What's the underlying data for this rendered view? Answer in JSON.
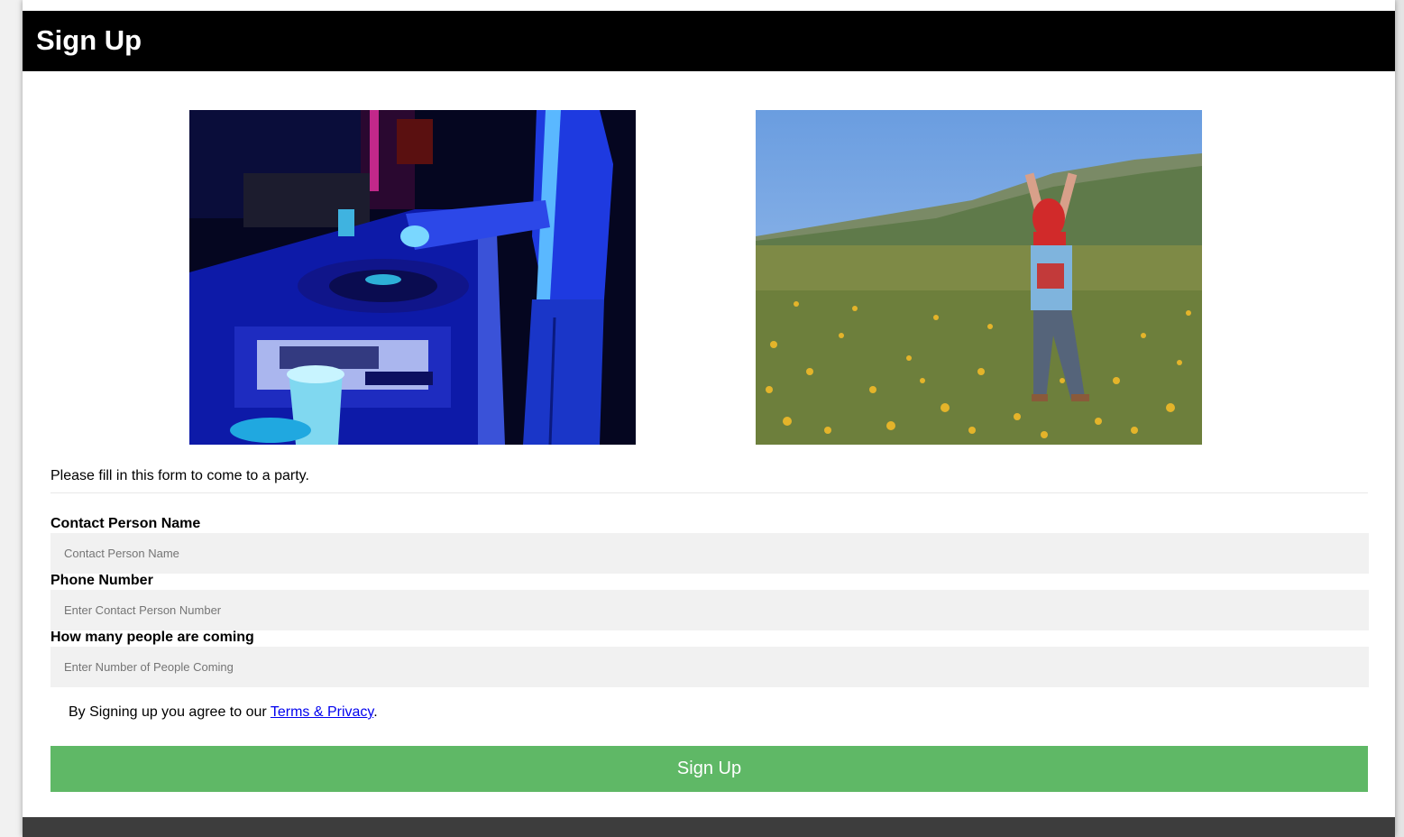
{
  "header": {
    "title": "Sign Up"
  },
  "images": [
    {
      "name": "dj-turntables-photo"
    },
    {
      "name": "child-in-flower-field-photo"
    }
  ],
  "form": {
    "intro": "Please fill in this form to come to a party.",
    "fields": [
      {
        "label": "Contact Person Name",
        "placeholder": "Contact Person Name",
        "value": ""
      },
      {
        "label": "Phone Number",
        "placeholder": "Enter Contact Person Number",
        "value": ""
      },
      {
        "label": "How many people are coming",
        "placeholder": "Enter Number of People Coming",
        "value": ""
      }
    ],
    "terms_prefix": "By Signing up you agree to our ",
    "terms_link": "Terms & Privacy",
    "terms_suffix": ".",
    "submit_label": "Sign Up"
  },
  "colors": {
    "header_bg": "#000000",
    "button_bg": "#5fb866",
    "input_bg": "#f1f1f1",
    "footer_bg": "#3d3d3d",
    "link": "#0000ee"
  }
}
